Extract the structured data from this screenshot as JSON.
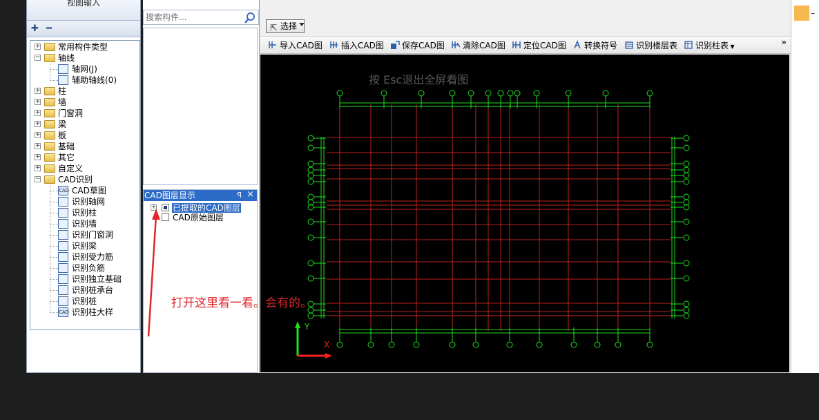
{
  "left_panel": {
    "title_partial": "视图输入",
    "toolbar": {
      "add_icon": "add-tree-icon",
      "remove_icon": "collapse-tree-icon"
    },
    "tree": [
      {
        "label": "常用构件类型",
        "expanded": false
      },
      {
        "label": "轴线",
        "expanded": true,
        "children": [
          "轴网(J)",
          "辅助轴线(0)"
        ]
      },
      {
        "label": "柱",
        "expanded": false
      },
      {
        "label": "墙",
        "expanded": false
      },
      {
        "label": "门窗洞",
        "expanded": false
      },
      {
        "label": "梁",
        "expanded": false
      },
      {
        "label": "板",
        "expanded": false
      },
      {
        "label": "基础",
        "expanded": false
      },
      {
        "label": "其它",
        "expanded": false
      },
      {
        "label": "自定义",
        "expanded": false
      },
      {
        "label": "CAD识别",
        "expanded": true,
        "children": [
          "CAD草图",
          "识别轴网",
          "识别柱",
          "识别墙",
          "识别门窗洞",
          "识别梁",
          "识别受力筋",
          "识别负筋",
          "识别独立基础",
          "识别桩承台",
          "识别桩",
          "识别柱大样"
        ]
      }
    ]
  },
  "search": {
    "placeholder": "搜索构件..."
  },
  "layer_panel": {
    "title": "CAD图层显示",
    "pin": "ᵖ",
    "close": "×",
    "items": [
      {
        "label": "已提取的CAD图层",
        "checked": true,
        "selected": true
      },
      {
        "label": "CAD原始图层",
        "checked": false,
        "selected": false
      }
    ]
  },
  "select_button": {
    "label": "选择"
  },
  "toolbar": {
    "items": [
      "导入CAD图",
      "插入CAD图",
      "保存CAD图",
      "清除CAD图",
      "定位CAD图",
      "转换符号",
      "识别楼层表",
      "识别柱表"
    ],
    "overflow": "»"
  },
  "canvas": {
    "hint": "按 Esc退出全屏看图",
    "axis_x_label": "X",
    "axis_y_label": "Y"
  },
  "annotation": {
    "text": "打开这里看一看。会有的。"
  },
  "colors": {
    "grid_green": "#1ee01e",
    "beam_red": "#c21f1f",
    "axis_red": "#ff2020",
    "selection_blue": "#2c6bc6",
    "annotation_red": "#e2262b"
  }
}
